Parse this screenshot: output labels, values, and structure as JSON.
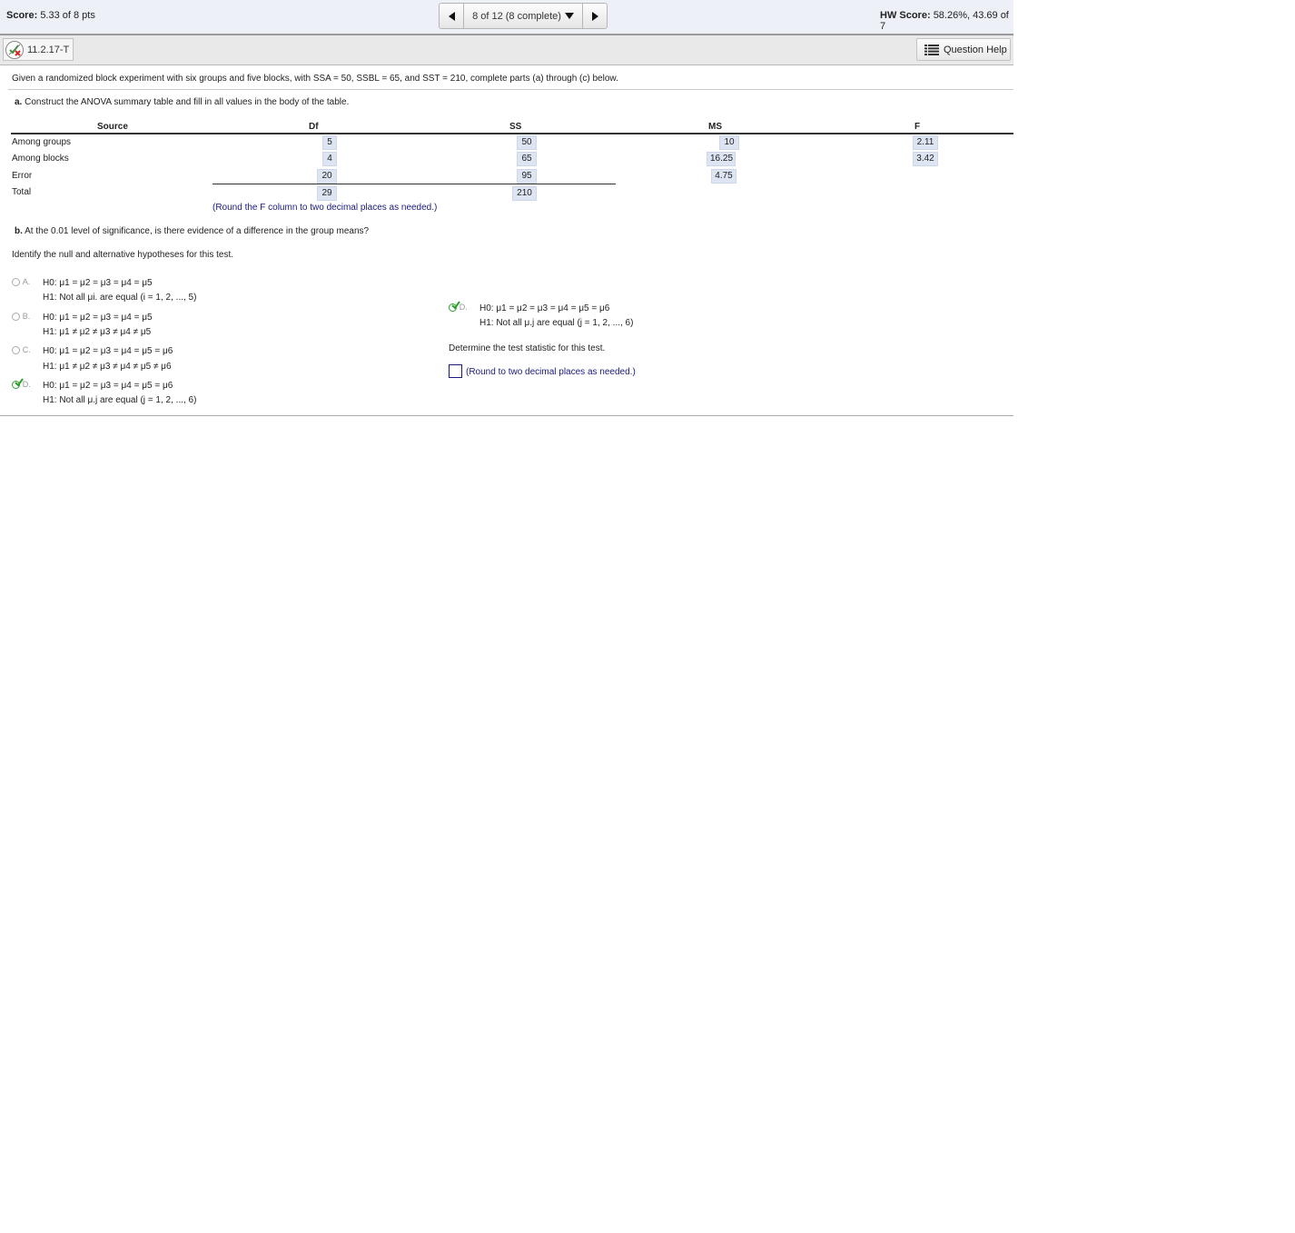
{
  "topbar": {
    "score_label": "Score:",
    "score_value": "5.33 of 8 pts",
    "nav_text": "8 of 12 (8 complete)",
    "hw_label": "HW Score:",
    "hw_value": "58.26%, 43.69 of 7"
  },
  "question": {
    "id": "11.2.17-T",
    "help_label": "Question Help"
  },
  "prompt": "Given a randomized block experiment with six groups and five blocks, with SSA = 50, SSBL = 65, and SST = 210, complete parts (a) through (c) below.",
  "part_a": {
    "label": "a.",
    "text": "Construct the ANOVA summary table and fill in all values in the body of the table.",
    "headers": {
      "source": "Source",
      "df": "Df",
      "ss": "SS",
      "ms": "MS",
      "f": "F"
    },
    "rows": [
      {
        "source": "Among groups",
        "df": "5",
        "ss": "50",
        "ms": "10",
        "f": "2.11"
      },
      {
        "source": "Among blocks",
        "df": "4",
        "ss": "65",
        "ms": "16.25",
        "f": "3.42"
      },
      {
        "source": "Error",
        "df": "20",
        "ss": "95",
        "ms": "4.75"
      },
      {
        "source": "Total",
        "df": "29",
        "ss": "210"
      }
    ],
    "note": "(Round the F column to two decimal places as needed.)"
  },
  "part_b": {
    "label": "b.",
    "text": "At the 0.01 level of significance, is there evidence of a difference in the group means?",
    "identify": "Identify the null and alternative hypotheses for this test.",
    "options": [
      {
        "letter": "A.",
        "h0": "H0: μ1 = μ2 = μ3 = μ4 = μ5",
        "h1": "H1: Not all μi. are equal (i = 1, 2, ..., 5)"
      },
      {
        "letter": "B.",
        "h0": "H0: μ1 = μ2 = μ3 = μ4 = μ5",
        "h1": "H1: μ1 ≠ μ2 ≠ μ3 ≠ μ4 ≠ μ5"
      },
      {
        "letter": "C.",
        "h0": "H0: μ1 = μ2 = μ3 = μ4 = μ5 = μ6",
        "h1": "H1: μ1 ≠ μ2 ≠ μ3 ≠ μ4 ≠ μ5 ≠ μ6"
      },
      {
        "letter": "D.",
        "h0": "H0: μ1 = μ2 = μ3 = μ4 = μ5 = μ6",
        "h1": "H1: Not all μ.j are equal (j = 1, 2, ..., 6)"
      }
    ],
    "selected_answer": {
      "letter": "D.",
      "h0": "H0: μ1 = μ2 = μ3 = μ4 = μ5 = μ6",
      "h1": "H1: Not all μ.j are equal (j = 1, 2, ..., 6)"
    },
    "test_stat_prompt": "Determine the test statistic for this test.",
    "test_stat_value": "",
    "test_stat_note": "(Round to two decimal places as needed.)"
  },
  "colors": {
    "accent_blue": "#1a1a7a",
    "cell_bg": "#dde5f3",
    "correct_green": "#2aa02a"
  },
  "icons": [
    "arrow-left-icon",
    "dropdown-icon",
    "arrow-right-icon",
    "mixed-result-icon",
    "list-icon"
  ]
}
